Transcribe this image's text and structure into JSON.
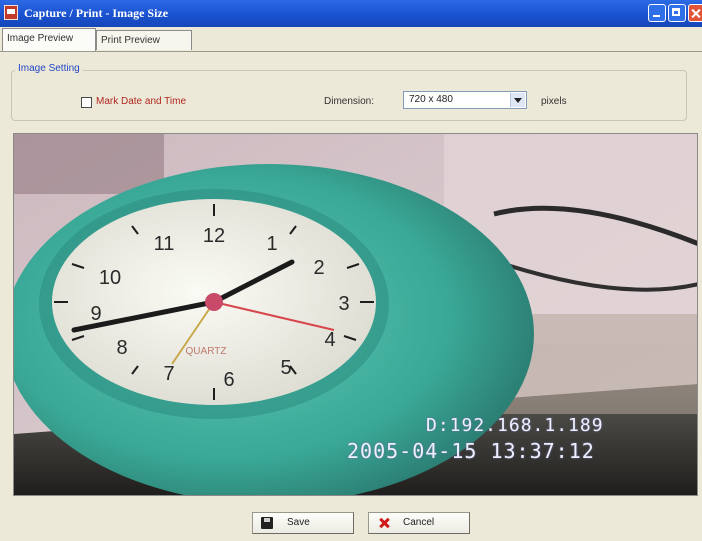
{
  "window": {
    "title": "Capture / Print - Image Size"
  },
  "tabs": [
    {
      "label": "Image Preview",
      "active": true
    },
    {
      "label": "Print Preview",
      "active": false
    }
  ],
  "image_setting": {
    "group_label": "Image Setting",
    "mark_date_time_label": "Mark Date and Time",
    "mark_date_time_checked": false,
    "dimension_label": "Dimension:",
    "dimension_value": "720 x 480",
    "unit_label": "pixels"
  },
  "preview": {
    "overlay_ip": "D:192.168.1.189",
    "overlay_datetime": "2005-04-15 13:37:12",
    "clock_brand": "QUARTZ",
    "clock_numbers": [
      "12",
      "1",
      "2",
      "3",
      "4",
      "5",
      "6",
      "7",
      "8",
      "9",
      "10",
      "11"
    ]
  },
  "buttons": {
    "save_label": "Save",
    "cancel_label": "Cancel"
  },
  "colors": {
    "titlebar": "#1a52d0",
    "window_bg": "#ece9d8",
    "group_label": "#2447c6",
    "checkbox_label": "#b0271e"
  }
}
